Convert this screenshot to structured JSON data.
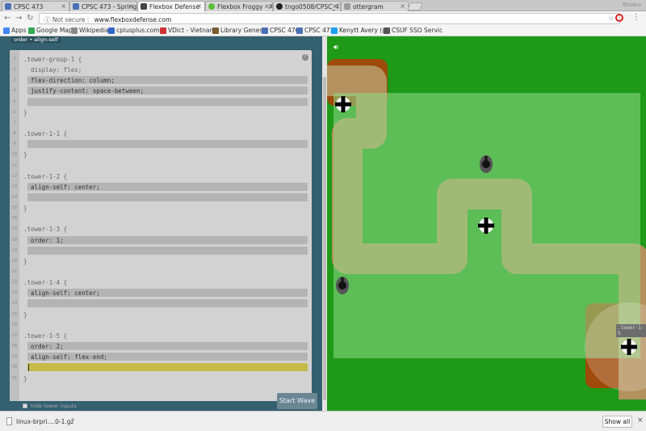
{
  "browser": {
    "tabs": [
      {
        "label": "CPSC 473",
        "active": false
      },
      {
        "label": "CPSC 473 - Spring 2",
        "active": false
      },
      {
        "label": "Flexbox Defense",
        "active": true
      },
      {
        "label": "Flexbox Froggy - A",
        "active": false
      },
      {
        "label": "tngo0508/CPSC_47",
        "active": false
      },
      {
        "label": "ottergram",
        "active": false
      }
    ],
    "profile": "Tonaru",
    "security_label": "Not secure",
    "url": "www.flexboxdefense.com"
  },
  "bookmarks": [
    {
      "label": "Apps",
      "color": "#4285f4"
    },
    {
      "label": "Google Maps",
      "color": "#34a853"
    },
    {
      "label": "Wikipedia",
      "color": "#888888"
    },
    {
      "label": "cplusplus.com -",
      "color": "#3366cc"
    },
    {
      "label": "VDict - Vietnam",
      "color": "#cc3333"
    },
    {
      "label": "Library Genesis",
      "color": "#7a5c2e"
    },
    {
      "label": "CPSC 476",
      "color": "#4a6fb5"
    },
    {
      "label": "CPSC 473",
      "color": "#4a6fb5"
    },
    {
      "label": "Kenytt Avery (@",
      "color": "#1da1f2"
    },
    {
      "label": "CSUF SSO Servic",
      "color": "#555555"
    }
  ],
  "editor": {
    "breadcrumb": "order • align-self",
    "lines": [
      {
        "n": "1",
        "text": ".tower-group-1 {",
        "bright": false
      },
      {
        "n": "2",
        "text": "  display: flex;",
        "bright": false
      },
      {
        "n": "3",
        "text": "  flex-direction: column;",
        "bright": true
      },
      {
        "n": "4",
        "text": "  justify-content: space-between;",
        "bright": true
      },
      {
        "n": "5",
        "text": "",
        "bright": true
      },
      {
        "n": "6",
        "text": "}",
        "bright": false
      },
      {
        "n": "7",
        "text": "",
        "bright": false
      },
      {
        "n": "8",
        "text": ".tower-1-1 {",
        "bright": false
      },
      {
        "n": "9",
        "text": "",
        "bright": true
      },
      {
        "n": "10",
        "text": "}",
        "bright": false
      },
      {
        "n": "11",
        "text": "",
        "bright": false
      },
      {
        "n": "12",
        "text": ".tower-1-2 {",
        "bright": false
      },
      {
        "n": "13",
        "text": "  align-self: center;",
        "bright": true
      },
      {
        "n": "14",
        "text": "",
        "bright": true
      },
      {
        "n": "15",
        "text": "}",
        "bright": false
      },
      {
        "n": "16",
        "text": "",
        "bright": false
      },
      {
        "n": "17",
        "text": ".tower-1-3 {",
        "bright": false
      },
      {
        "n": "18",
        "text": "  order: 1;",
        "bright": true
      },
      {
        "n": "19",
        "text": "",
        "bright": true
      },
      {
        "n": "20",
        "text": "}",
        "bright": false
      },
      {
        "n": "21",
        "text": "",
        "bright": false
      },
      {
        "n": "22",
        "text": ".tower-1-4 {",
        "bright": false
      },
      {
        "n": "23",
        "text": "  align-self: center;",
        "bright": true
      },
      {
        "n": "24",
        "text": "",
        "bright": true
      },
      {
        "n": "25",
        "text": "}",
        "bright": false
      },
      {
        "n": "26",
        "text": "",
        "bright": false
      },
      {
        "n": "27",
        "text": ".tower-1-5 {",
        "bright": false
      },
      {
        "n": "28",
        "text": "  order: 2;",
        "bright": true
      },
      {
        "n": "29",
        "text": "  align-self: flex-end;",
        "bright": true
      },
      {
        "n": "30",
        "text": "",
        "bright": true
      },
      {
        "n": "31",
        "text": "}",
        "bright": false
      }
    ],
    "hide_inputs_label": "hide tower inputs",
    "start_button": "Start Wave",
    "help_icon": "?"
  },
  "game": {
    "tower_label": ".tower-1-5",
    "colors": {
      "grass": "#1f9a18",
      "path": "#b3925e",
      "group_overlay": "#8fdb8a",
      "dirt": "#9e4a0a"
    }
  },
  "downloads": {
    "file_name": "linux-brpri....0-1.gz",
    "show_all": "Show all"
  }
}
